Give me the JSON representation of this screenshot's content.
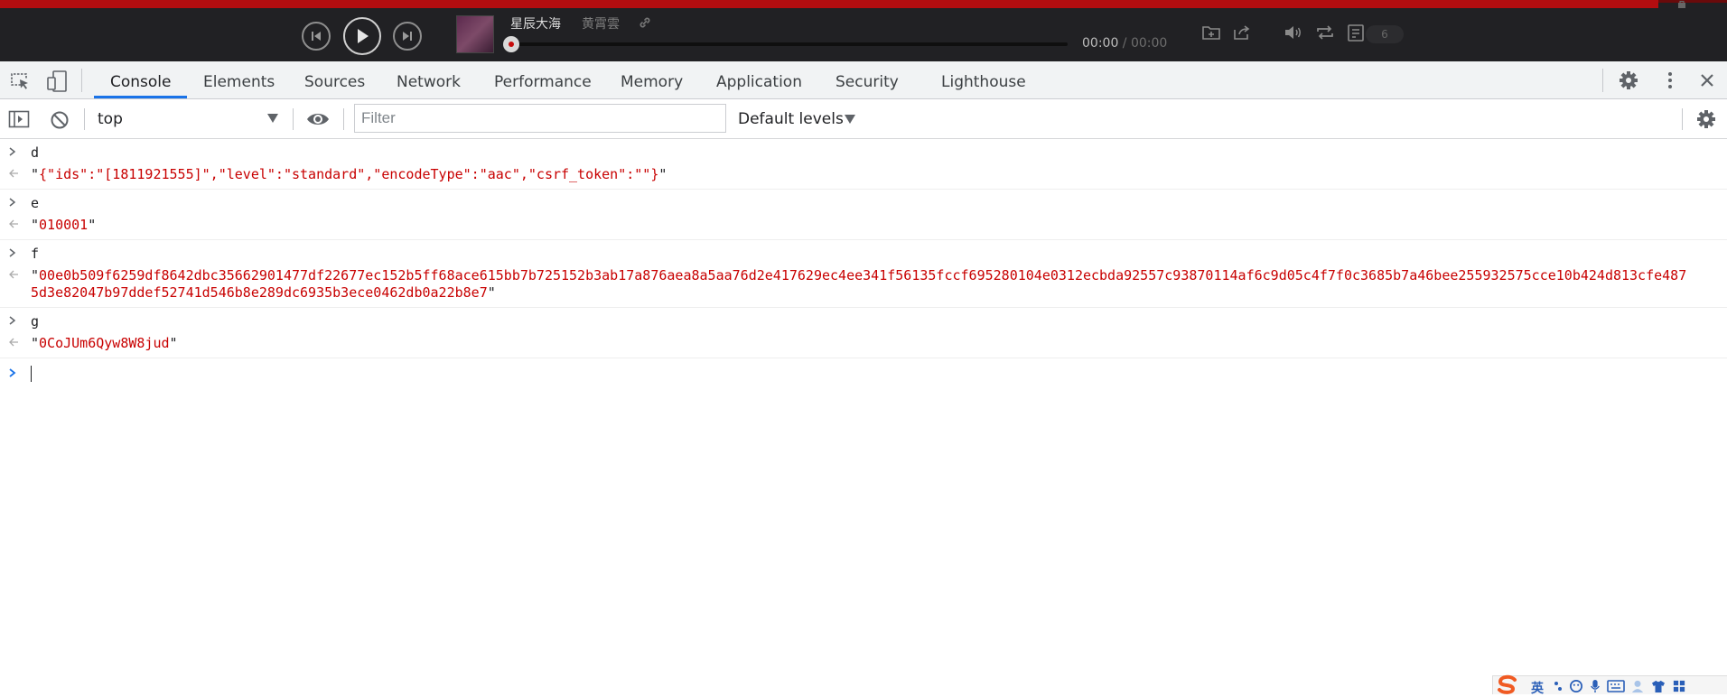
{
  "player": {
    "song_title": "星辰大海",
    "artist": "黄霄雲",
    "time_current": "00:00",
    "time_separator": " / ",
    "time_total": "00:00",
    "playlist_count": "6",
    "progress": 0,
    "accent_color": "#c70c0c"
  },
  "devtools": {
    "tabs": [
      "Console",
      "Elements",
      "Sources",
      "Network",
      "Performance",
      "Memory",
      "Application",
      "Security",
      "Lighthouse"
    ],
    "active_tab": "Console",
    "accent_color": "#1a73e8"
  },
  "console_toolbar": {
    "context": "top",
    "filter_placeholder": "Filter",
    "filter_value": "",
    "levels": "Default levels"
  },
  "console_entries": [
    {
      "input": "d",
      "result_open": "\"",
      "result": "{\"ids\":\"[1811921555]\",\"level\":\"standard\",\"encodeType\":\"aac\",\"csrf_token\":\"\"}",
      "result_close": "\""
    },
    {
      "input": "e",
      "result_open": "\"",
      "result": "010001",
      "result_close": "\""
    },
    {
      "input": "f",
      "result_open": "\"",
      "result": "00e0b509f6259df8642dbc35662901477df22677ec152b5ff68ace615bb7b725152b3ab17a876aea8a5aa76d2e417629ec4ee341f56135fccf695280104e0312ecbda92557c93870114af6c9d05c4f7f0c3685b7a46bee255932575cce10b424d813cfe4875d3e82047b97ddef52741d546b8e289dc6935b3ece0462db0a22b8e7",
      "result_close": "\""
    },
    {
      "input": "g",
      "result_open": "\"",
      "result": "0CoJUm6Qyw8W8jud",
      "result_close": "\""
    }
  ],
  "ime": {
    "lang": "英"
  }
}
